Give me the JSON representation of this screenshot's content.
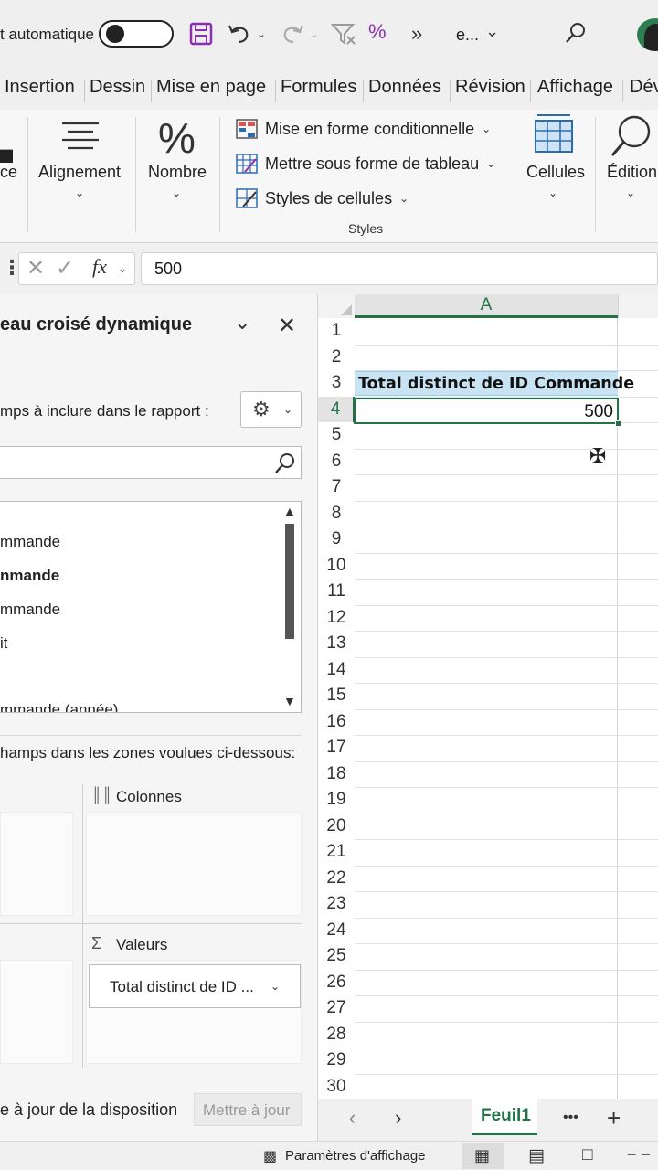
{
  "titlebar": {
    "autosave_label": "t automatique",
    "more_glyph": "»",
    "filename": "e..."
  },
  "tabs": [
    "Insertion",
    "Dessin",
    "Mise en page",
    "Formules",
    "Données",
    "Révision",
    "Affichage",
    "Dév"
  ],
  "ribbon": {
    "clipboard_label": "ce",
    "alignment_label": "Alignement",
    "number_label": "Nombre",
    "styles": {
      "conditional": "Mise en forme conditionnelle",
      "table": "Mettre sous forme de tableau",
      "cell_styles": "Styles de cellules",
      "group_label": "Styles"
    },
    "cells_label": "Cellules",
    "editing_label": "Édition"
  },
  "formula_bar": {
    "fx": "fx",
    "value": "500"
  },
  "pivot_pane": {
    "title": "eau croisé dynamique",
    "choose_fields": "mps à inclure dans le rapport :",
    "search_placeholder": "",
    "fields": [
      {
        "label": "mmande",
        "bold": false
      },
      {
        "label": "nmande",
        "bold": true
      },
      {
        "label": "mmande",
        "bold": false
      },
      {
        "label": "it",
        "bold": false
      },
      {
        "label": "",
        "bold": false
      },
      {
        "label": "mmande (année)",
        "bold": false
      }
    ],
    "drag_hint": "hamps dans les zones voulues ci-dessous:",
    "zones": {
      "columns": "Colonnes",
      "values": "Valeurs",
      "values_item": "Total distinct de ID ..."
    },
    "defer_label": "e à jour de la disposition",
    "update_button": "Mettre à jour"
  },
  "grid": {
    "column_header": "A",
    "rows": [
      "1",
      "2",
      "3",
      "4",
      "5",
      "6",
      "7",
      "8",
      "9",
      "10",
      "11",
      "12",
      "13",
      "14",
      "15",
      "16",
      "17",
      "18",
      "19",
      "20",
      "21",
      "22",
      "23",
      "24",
      "25",
      "26",
      "27",
      "28",
      "29",
      "30"
    ],
    "header_cell": "Total distinct de ID Commande",
    "value_cell": "500"
  },
  "sheetbar": {
    "sheet_name": "Feuil1",
    "more": "•••",
    "add": "+"
  },
  "status": {
    "display_settings": "Paramètres d'affichage"
  },
  "colors": {
    "accent_green": "#217346",
    "header_fill": "#c8e3f3",
    "save_purple": "#8b2fb0"
  }
}
